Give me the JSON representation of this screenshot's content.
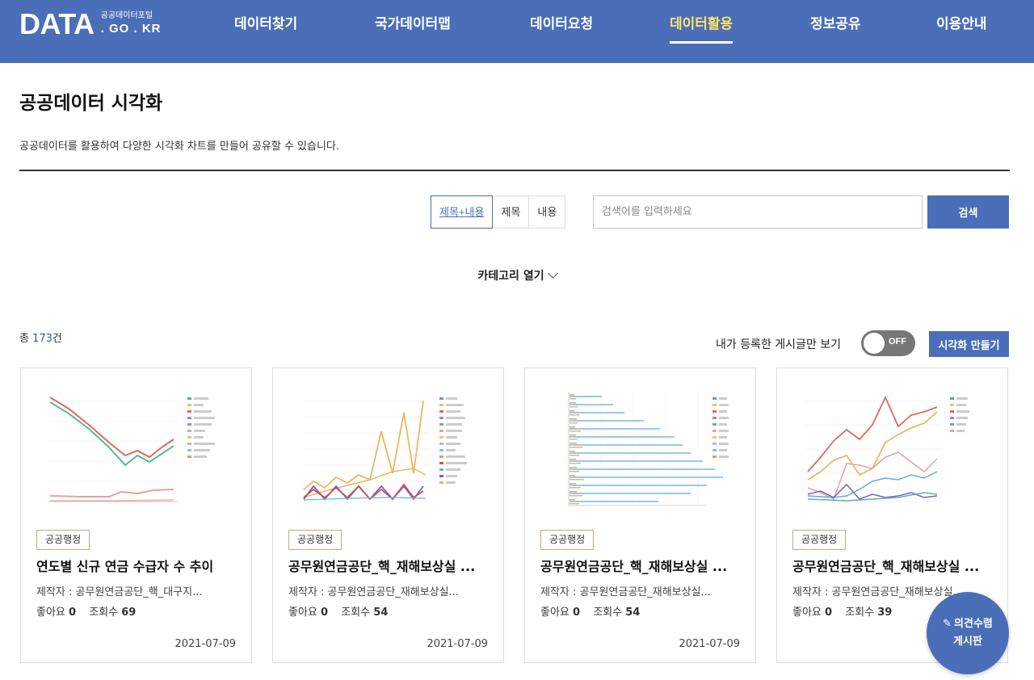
{
  "logo": {
    "main": "DATA",
    "sub_top": "공공데이터포털",
    "sub_bottom": ". GO . KR"
  },
  "nav": [
    {
      "label": "데이터찾기",
      "active": false
    },
    {
      "label": "국가데이터맵",
      "active": false
    },
    {
      "label": "데이터요청",
      "active": false
    },
    {
      "label": "데이터활용",
      "active": true
    },
    {
      "label": "정보공유",
      "active": false
    },
    {
      "label": "이용안내",
      "active": false
    }
  ],
  "page": {
    "title": "공공데이터 시각화",
    "description": "공공데이터를 활용하여 다양한 시각화 차트를 만들어 공유할 수 있습니다."
  },
  "search": {
    "tabs": [
      "제목+내용",
      "제목",
      "내용"
    ],
    "active_tab": "제목+내용",
    "placeholder": "검색어를 입력하세요",
    "button": "검색"
  },
  "category_toggle": "카테고리 열기",
  "total": {
    "prefix": "총 ",
    "count": "173",
    "suffix": "건"
  },
  "my_posts_toggle": {
    "label": "내가 등록한 게시글만 보기",
    "state": "OFF"
  },
  "create_button": "시각화 만들기",
  "cards": [
    {
      "badge": "공공행정",
      "title": "연도별 신규 연금 수급자 수 추이",
      "author": "제작자 : 공무원연금공단_핵_대구지...",
      "likes_label": "좋아요",
      "likes": "0",
      "views_label": "조회수",
      "views": "69",
      "date": "2021-07-09",
      "thumb": "line-trend"
    },
    {
      "badge": "공공행정",
      "title": "공무원연금공단_핵_재해보상실 ...",
      "author": "제작자 : 공무원연금공단_재해보상실...",
      "likes_label": "좋아요",
      "likes": "0",
      "views_label": "조회수",
      "views": "54",
      "date": "2021-07-09",
      "thumb": "line-zigzag"
    },
    {
      "badge": "공공행정",
      "title": "공무원연금공단_핵_재해보상실 ...",
      "author": "제작자 : 공무원연금공단_재해보상실...",
      "likes_label": "좋아요",
      "likes": "0",
      "views_label": "조회수",
      "views": "54",
      "date": "2021-07-09",
      "thumb": "hbar"
    },
    {
      "badge": "공공행정",
      "title": "공무원연금공단_핵_재해보상실 ...",
      "author": "제작자 : 공무원연금공단_재해보상실...",
      "likes_label": "좋아요",
      "likes": "0",
      "views_label": "조회수",
      "views": "39",
      "date": "",
      "thumb": "line-multi"
    }
  ],
  "floating": {
    "line1": "의견수렴",
    "line2": "게시판",
    "icon": "pencil-icon"
  },
  "colors": {
    "primary": "#4a6fb8",
    "active_nav": "#ffe56b",
    "badge_border": "#c8a87a"
  }
}
